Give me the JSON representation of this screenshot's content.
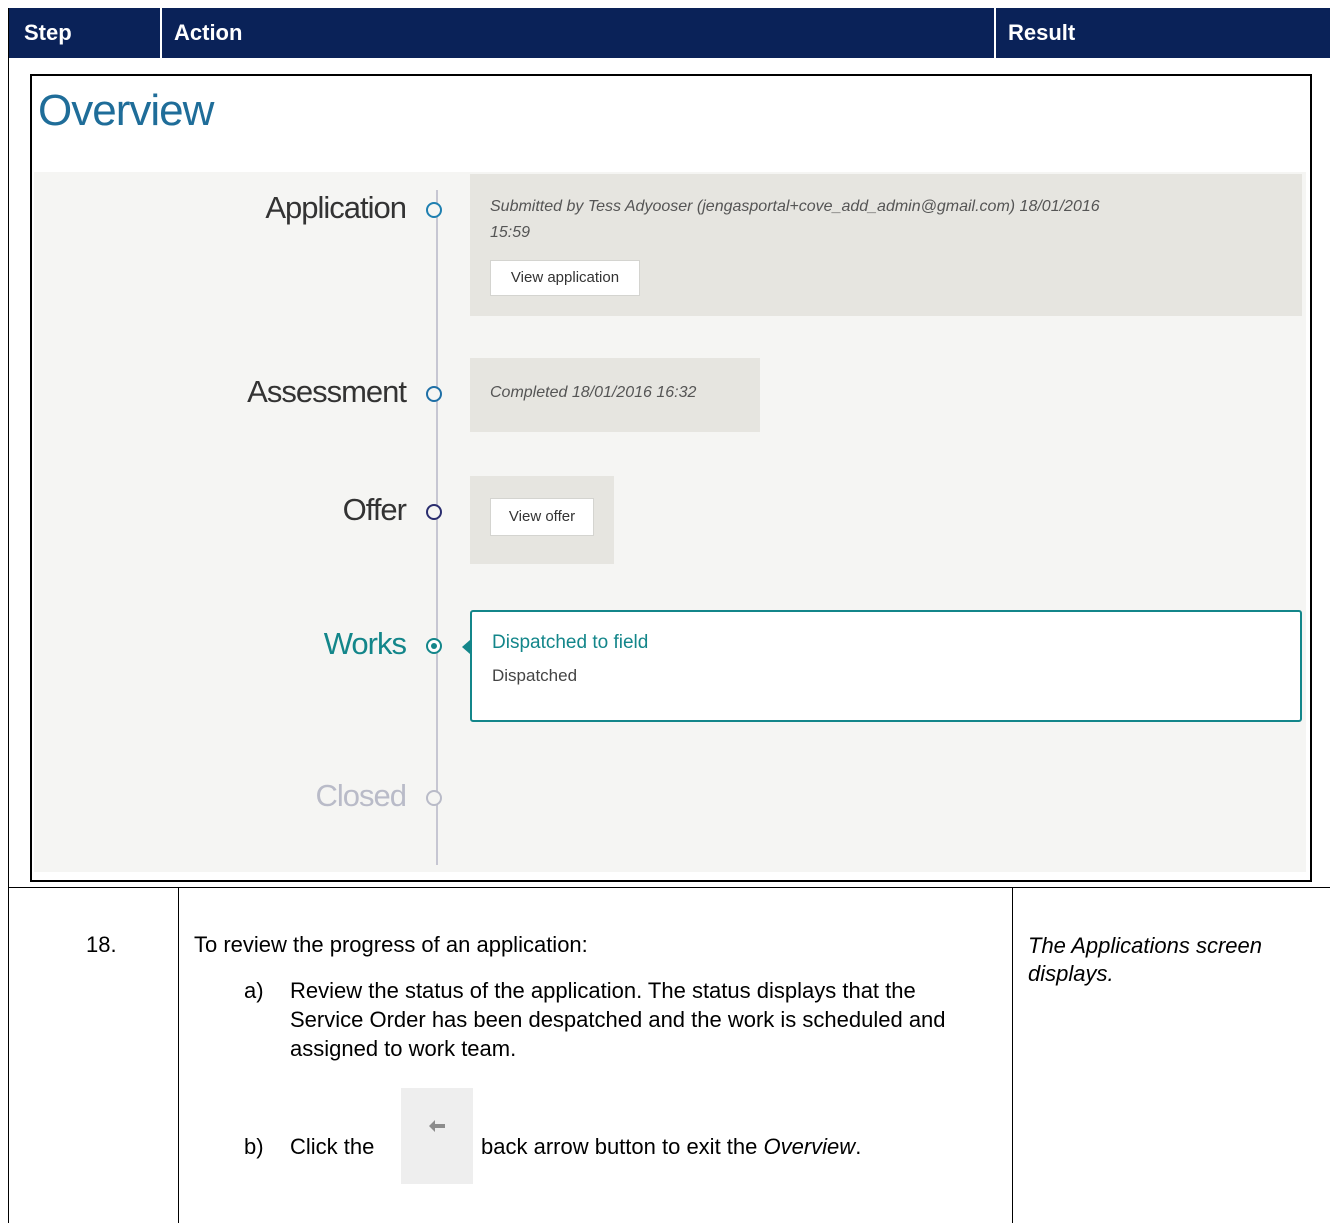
{
  "table": {
    "headers": {
      "step": "Step",
      "action": "Action",
      "result": "Result"
    }
  },
  "overview": {
    "title": "Overview",
    "steps": [
      {
        "label": "Application",
        "color": "#1e7fb0"
      },
      {
        "label": "Assessment",
        "color": "#1e6fa6"
      },
      {
        "label": "Offer",
        "color": "#2a2d6e"
      },
      {
        "label": "Works",
        "color": "#13868a"
      },
      {
        "label": "Closed",
        "color": "#b9bbc8"
      }
    ],
    "application_card": {
      "note_line1": "Submitted by Tess Adyooser (jengasportal+cove_add_admin@gmail.com) 18/01/2016",
      "note_line2": "15:59",
      "button": "View application"
    },
    "assessment_card": {
      "note": "Completed 18/01/2016 16:32"
    },
    "offer_card": {
      "button": "View offer"
    },
    "works_card": {
      "title": "Dispatched to field",
      "status": "Dispatched"
    }
  },
  "instruction": {
    "step_number": "18.",
    "intro": "To review the progress of an application:",
    "a_label": "a)",
    "a_text": "Review the status of the application. The status displays that the Service Order has been despatched and the work is scheduled and assigned to work team.",
    "b_label": "b)",
    "b_before": "Click the",
    "b_after": "back arrow button to exit the",
    "b_emph": "Overview",
    "b_end": ".",
    "result": "The Applications screen displays."
  },
  "colors": {
    "header_bg": "#0a2258",
    "overview_title": "#1f6d99",
    "works_accent": "#13868a"
  }
}
